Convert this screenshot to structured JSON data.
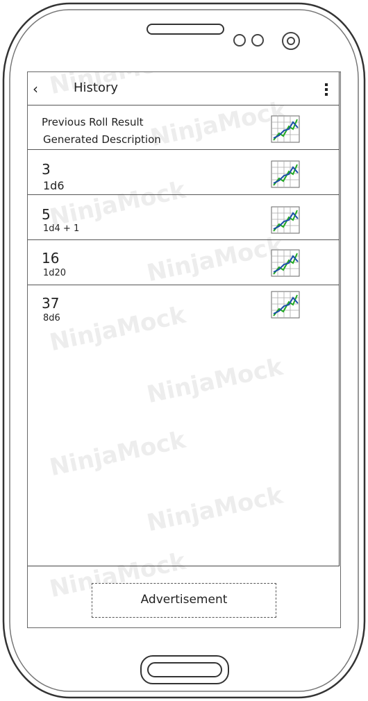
{
  "header": {
    "back_glyph": "‹",
    "title": "History"
  },
  "history": [
    {
      "result": "Previous Roll Result",
      "description": "Generated Description"
    },
    {
      "result": "3",
      "description": "1d6"
    },
    {
      "result": "5",
      "description": "1d4 + 1"
    },
    {
      "result": "16",
      "description": "1d20"
    },
    {
      "result": "37",
      "description": "8d6"
    }
  ],
  "footer": {
    "ad_label": "Advertisement"
  },
  "watermark_text": "NinjaMock",
  "colors": {
    "chart_line_green": "#22aa22",
    "chart_line_blue": "#1a4ea8",
    "outline": "#333333"
  }
}
